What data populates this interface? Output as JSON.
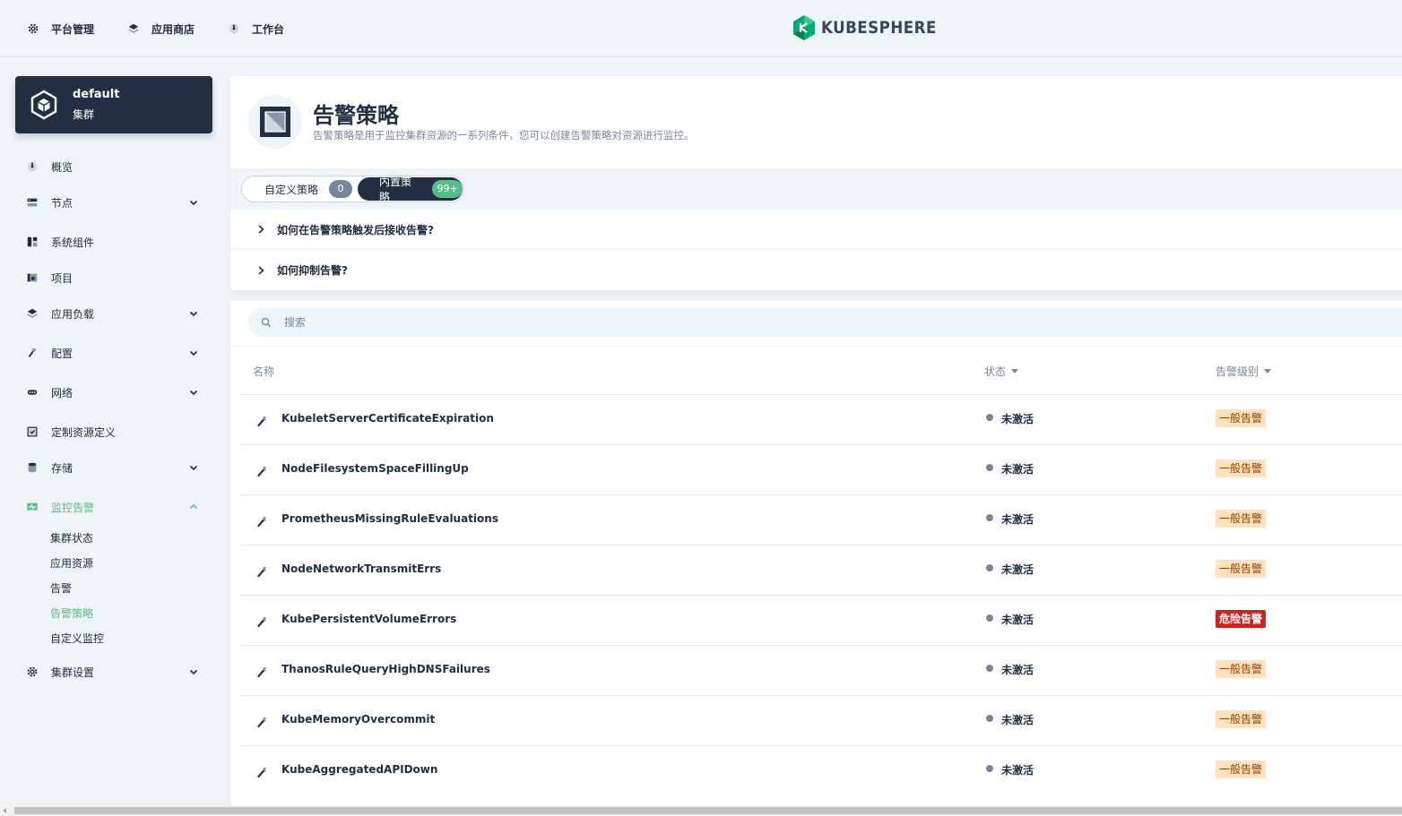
{
  "topnav": {
    "items": [
      {
        "label": "平台管理",
        "icon": "gear-icon"
      },
      {
        "label": "应用商店",
        "icon": "layers-icon"
      },
      {
        "label": "工作台",
        "icon": "dashboard-icon"
      }
    ],
    "logo_text": "KUBESPHERE"
  },
  "cluster": {
    "name": "default",
    "type": "集群"
  },
  "sidebar": {
    "items": [
      {
        "label": "概览",
        "icon": "dashboard-icon",
        "expandable": false
      },
      {
        "label": "节点",
        "icon": "server-icon",
        "expandable": true
      },
      {
        "label": "系统组件",
        "icon": "components-icon",
        "expandable": false
      },
      {
        "label": "项目",
        "icon": "project-icon",
        "expandable": false
      },
      {
        "label": "应用负载",
        "icon": "layers-icon",
        "expandable": true
      },
      {
        "label": "配置",
        "icon": "hammer-icon",
        "expandable": true
      },
      {
        "label": "网络",
        "icon": "network-icon",
        "expandable": true
      },
      {
        "label": "定制资源定义",
        "icon": "crd-icon",
        "expandable": false
      },
      {
        "label": "存储",
        "icon": "database-icon",
        "expandable": true
      },
      {
        "label": "监控告警",
        "icon": "monitor-icon",
        "expandable": true,
        "expanded": true,
        "active": true
      },
      {
        "label": "集群设置",
        "icon": "gear-icon",
        "expandable": true
      }
    ],
    "subitems": [
      {
        "label": "集群状态"
      },
      {
        "label": "应用资源"
      },
      {
        "label": "告警"
      },
      {
        "label": "告警策略",
        "active": true
      },
      {
        "label": "自定义监控"
      }
    ]
  },
  "header": {
    "title": "告警策略",
    "description": "告警策略是用于监控集群资源的一系列条件，您可以创建告警策略对资源进行监控。",
    "tabs": [
      {
        "label": "自定义策略",
        "count": "0"
      },
      {
        "label": "内置策略",
        "count": "99+",
        "active": true
      }
    ],
    "faqs": [
      {
        "label": "如何在告警策略触发后接收告警?"
      },
      {
        "label": "如何抑制告警?"
      }
    ]
  },
  "search": {
    "placeholder": "搜索"
  },
  "table": {
    "columns": {
      "name": "名称",
      "status": "状态",
      "severity": "告警级别"
    },
    "rows": [
      {
        "name": "KubeletServerCertificateExpiration",
        "status": "未激活",
        "severity": "一般告警",
        "level": "warning"
      },
      {
        "name": "NodeFilesystemSpaceFillingUp",
        "status": "未激活",
        "severity": "一般告警",
        "level": "warning"
      },
      {
        "name": "PrometheusMissingRuleEvaluations",
        "status": "未激活",
        "severity": "一般告警",
        "level": "warning"
      },
      {
        "name": "NodeNetworkTransmitErrs",
        "status": "未激活",
        "severity": "一般告警",
        "level": "warning"
      },
      {
        "name": "KubePersistentVolumeErrors",
        "status": "未激活",
        "severity": "危险告警",
        "level": "critical"
      },
      {
        "name": "ThanosRuleQueryHighDNSFailures",
        "status": "未激活",
        "severity": "一般告警",
        "level": "warning"
      },
      {
        "name": "KubeMemoryOvercommit",
        "status": "未激活",
        "severity": "一般告警",
        "level": "warning"
      },
      {
        "name": "KubeAggregatedAPIDown",
        "status": "未激活",
        "severity": "一般告警",
        "level": "warning"
      }
    ]
  },
  "colors": {
    "accent": "#55bc8a",
    "dark": "#242e42",
    "warning_bg": "#ffe1be",
    "critical_bg": "#ca2621"
  }
}
